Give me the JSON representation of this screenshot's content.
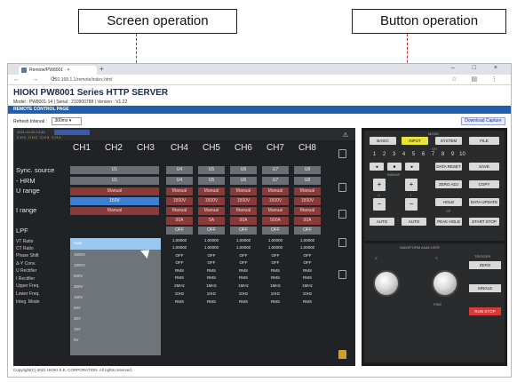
{
  "callouts": {
    "screen_operation": "Screen operation",
    "button_operation": "Button operation"
  },
  "browser": {
    "tab_title": "Remote/PW8001 · ×",
    "url": "192.168.1.1/remote/index.html",
    "window_controls": "– □ ×",
    "nav": "← → ⟳",
    "toolbar_icons": "☆ ▤ ⋮"
  },
  "page": {
    "title": "HIOKI PW8001 Series HTTP SERVER",
    "model_line": "Model : PW8001-14 | Serial : 210900788 | Version : V1.22",
    "bar_label": "REMOTE CONTROL PAGE",
    "refresh_label": "Refresh Interval :",
    "refresh_value": "300ms ▾",
    "download_label": "Download Capture",
    "footer": "Copyright(C) 2021 HIOKI E.E. CORPORATION. All rights reserved."
  },
  "screen": {
    "header_text": "2021-12-20 14:45",
    "header_bar": "CH1 CH2 CH3 CH4",
    "warning_icon": "⚠",
    "channels": [
      "CH1",
      "CH2",
      "CH3",
      "CH4",
      "CH5",
      "CH6",
      "CH7",
      "CH8"
    ],
    "row_labels": {
      "sync_source": "Sync. source",
      "hrm": "- HRM",
      "u_range": "U range",
      "i_range": "I range",
      "lpf": "LPF",
      "vt_ratio": "VT Ratio",
      "ct_ratio": "CT Ratio",
      "phase_shift": "Phase Shift",
      "dy_conv": "Δ-Y Conv.",
      "u_rectifier": "U Rectifier",
      "i_rectifier": "I Rectifier",
      "upper_freq": "Upper Freq.",
      "lower_freq": "Lower Freq.",
      "integ_mode": "Integ. Mode"
    },
    "sync_values": [
      "U1",
      "U4",
      "U5",
      "U6",
      "U7",
      "U8"
    ],
    "hrm_values": [
      "U1",
      "U4",
      "U5",
      "U6",
      "U7",
      "U8"
    ],
    "u_range_values": [
      "Manual",
      "Manual",
      "Manual",
      "Manual",
      "Manual",
      "Manual"
    ],
    "u_range_sub": [
      "150V",
      "1500V",
      "1500V",
      "1500V",
      "1500V",
      "1500V"
    ],
    "i_range_values": [
      "Manual",
      "Manual",
      "Manual",
      "Manual",
      "Manual",
      "Manual"
    ],
    "i_range_sub": [
      "50A",
      "5A",
      "50A",
      "500A",
      "50A"
    ],
    "lpf_values": [
      "OFF",
      "OFF",
      "OFF",
      "OFF",
      "OFF"
    ],
    "vt_values": [
      "1.00000",
      "1.00000",
      "1.00000",
      "1.00000",
      "1.00000"
    ],
    "ct_values": [
      "1.00000",
      "1.00000",
      "1.00000",
      "1.00000",
      "1.00000"
    ],
    "phase_values": [
      "OFF",
      "OFF",
      "OFF",
      "OFF",
      "OFF"
    ],
    "dy_values": [
      "OFF",
      "OFF",
      "OFF",
      "OFF",
      "OFF"
    ],
    "urect_values": [
      "RMS",
      "RMS",
      "RMS",
      "RMS",
      "RMS"
    ],
    "irect_values": [
      "RMS",
      "RMS",
      "RMS",
      "RMS",
      "RMS"
    ],
    "upper_values": [
      "2MHz",
      "1MHz",
      "1MHz",
      "1MHz",
      "1MHz"
    ],
    "lower_values": [
      "10Hz",
      "10Hz",
      "10Hz",
      "10Hz",
      "10Hz",
      "10Hz"
    ],
    "integ_values": [
      "RMS",
      "RMS",
      "RMS",
      "RMS",
      "RMS",
      "RMS"
    ],
    "dropdown_items": [
      "Auto",
      "1500V",
      "1000V",
      "600V",
      "300V",
      "150V",
      "60V",
      "30V",
      "15V",
      "6V"
    ],
    "dropdown_selected": "Auto"
  },
  "keys": {
    "mode_label": "MODE",
    "basic": "BASIC",
    "input": "INPUT",
    "system": "SYSTEM",
    "file": "FILE",
    "ch_label": "CH",
    "ch_numbers": [
      "1",
      "2",
      "3",
      "4",
      "5",
      "6",
      "7",
      "8",
      "9",
      "10"
    ],
    "range_label": "RANGE",
    "left_arrow": "◄",
    "ok": "■",
    "right_arrow": "►",
    "data_reset": "DATA RESET",
    "save": "SAVE",
    "copy": "COPY",
    "u_label": "U",
    "i_label": "I",
    "plus": "+",
    "minus": "−",
    "zero_adj": "ZERO ADJ",
    "hold": "HOLD",
    "data_update": "DATA UPDATE",
    "auto": "AUTO",
    "peak_hold": "PEAK HOLD",
    "start_stop": "START STOP",
    "cf_label": "CF",
    "waveform_label": "WAVEFORM ANALYZER",
    "knob_x": "X",
    "knob_y": "Y",
    "zero_label": "ZERO",
    "single": "SINGLE",
    "run_stop": "RUN STOP",
    "trigger_label": "TRIGGER",
    "fine_label": "FINE",
    "accent_yellow": "#e9e23a",
    "accent_red": "#d63a3a"
  }
}
